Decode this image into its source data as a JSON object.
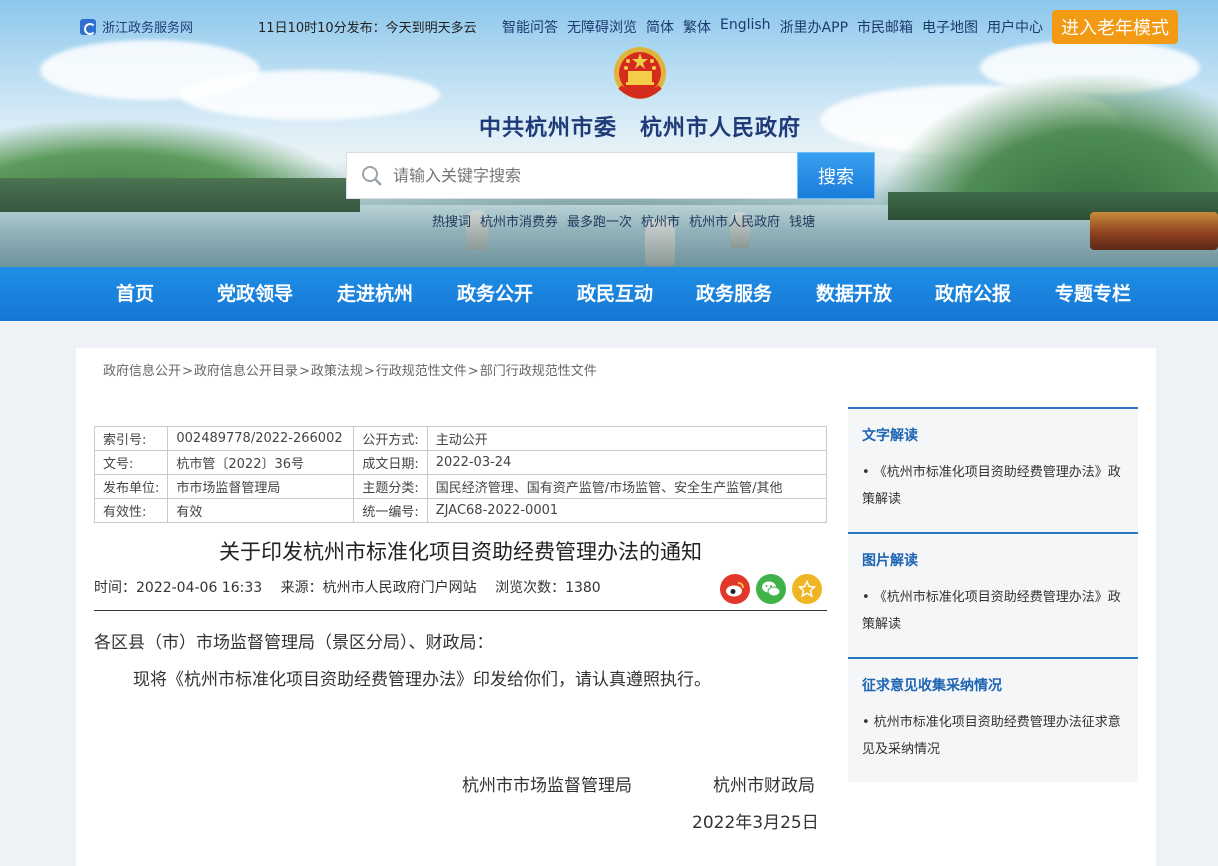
{
  "top": {
    "brand": "浙江政务服务网",
    "ticker": "11日10时10分发布：今天到明天多云",
    "links": [
      "智能问答",
      "无障碍浏览",
      "简体",
      "繁体",
      "English",
      "浙里办APP",
      "市民邮箱",
      "电子地图",
      "用户中心"
    ],
    "elder_mode": "进入老年模式"
  },
  "header": {
    "site_title": "中共杭州市委　杭州市人民政府",
    "search_placeholder": "请输入关键字搜索",
    "search_button": "搜索",
    "hotwords": [
      "热搜词",
      "杭州市消费券",
      "最多跑一次",
      "杭州市",
      "杭州市人民政府",
      "钱塘"
    ]
  },
  "nav": [
    "首页",
    "党政领导",
    "走进杭州",
    "政务公开",
    "政民互动",
    "政务服务",
    "数据开放",
    "政府公报",
    "专题专栏"
  ],
  "breadcrumb": [
    "政府信息公开",
    "政府信息公开目录",
    "政策法规",
    "行政规范性文件",
    "部门行政规范性文件"
  ],
  "meta": {
    "index_label": "索引号:",
    "index_value": "002489778/2022-266002",
    "open_label": "公开方式:",
    "open_value": "主动公开",
    "docno_label": "文号:",
    "docno_value": "杭市管〔2022〕36号",
    "date_label": "成文日期:",
    "date_value": "2022-03-24",
    "issuer_label": "发布单位:",
    "issuer_value": "市市场监督管理局",
    "topic_label": "主题分类:",
    "topic_value": "国民经济管理、国有资产监管/市场监管、安全生产监管/其他",
    "valid_label": "有效性:",
    "valid_value": "有效",
    "code_label": "统一编号:",
    "code_value": "ZJAC68-2022-0001"
  },
  "article": {
    "title": "关于印发杭州市标准化项目资助经费管理办法的通知",
    "time": "时间：2022-04-06 16:33",
    "source": "来源：杭州市人民政府门户网站",
    "views": "浏览次数：1380",
    "salutation": "各区县（市）市场监督管理局（景区分局）、财政局：",
    "body": "现将《杭州市标准化项目资助经费管理办法》印发给你们，请认真遵照执行。",
    "signer1": "杭州市市场监督管理局",
    "signer2": "杭州市财政局",
    "sign_date": "2022年3月25日"
  },
  "sidebar": [
    {
      "heading": "文字解读",
      "item": "• 《杭州市标准化项目资助经费管理办法》政策解读"
    },
    {
      "heading": "图片解读",
      "item": "• 《杭州市标准化项目资助经费管理办法》政策解读"
    },
    {
      "heading": "征求意见收集采纳情况",
      "item": "• 杭州市标准化项目资助经费管理办法征求意见及采纳情况"
    }
  ],
  "colors": {
    "nav": "#1577d4",
    "accent": "#f29a14",
    "link": "#1d64b3"
  },
  "icons": {
    "search": "search-icon",
    "weibo": "weibo-icon",
    "wechat": "wechat-icon",
    "favorite": "star-icon"
  }
}
